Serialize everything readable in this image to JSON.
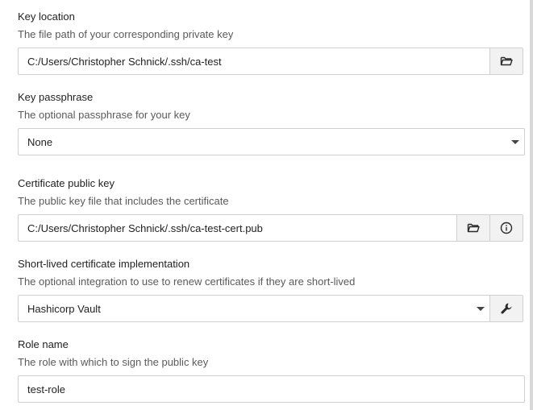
{
  "key_location": {
    "label": "Key location",
    "description": "The file path of your corresponding private key",
    "value": "C:/Users/Christopher Schnick/.ssh/ca-test",
    "browse_icon": "folder-open-icon"
  },
  "key_passphrase": {
    "label": "Key passphrase",
    "description": "The optional passphrase for your key",
    "selected": "None"
  },
  "certificate_public_key": {
    "label": "Certificate public key",
    "description": "The public key file that includes the certificate",
    "value": "C:/Users/Christopher Schnick/.ssh/ca-test-cert.pub",
    "browse_icon": "folder-open-icon",
    "info_icon": "info-icon"
  },
  "short_lived_cert": {
    "label": "Short-lived certificate implementation",
    "description": "The optional integration to use to renew certificates if they are short-lived",
    "selected": "Hashicorp Vault",
    "configure_icon": "wrench-icon"
  },
  "role_name": {
    "label": "Role name",
    "description": "The role with which to sign the public key",
    "value": "test-role"
  }
}
